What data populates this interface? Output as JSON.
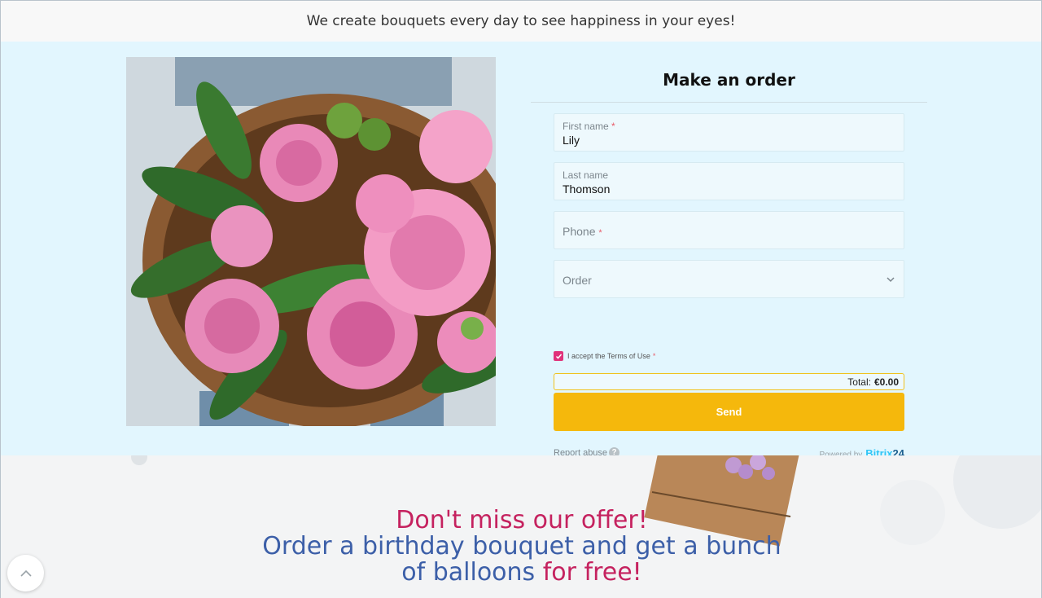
{
  "header": {
    "tagline": "We create bouquets every day to see happiness in your eyes!"
  },
  "form": {
    "title": "Make an order",
    "fields": {
      "first_name": {
        "label": "First name",
        "required_mark": "*",
        "value": "Lily"
      },
      "last_name": {
        "label": "Last name",
        "value": "Thomson"
      },
      "phone": {
        "placeholder": "Phone",
        "required_mark": "*"
      },
      "order": {
        "placeholder": "Order"
      }
    },
    "terms": {
      "label": "I accept the Terms of Use",
      "required_mark": "*",
      "checked": true
    },
    "total": {
      "label": "Total:",
      "value": "€0.00"
    },
    "send_label": "Send",
    "report_abuse": "Report abuse",
    "help_glyph": "?",
    "powered_by": "Powered by",
    "brand_name": "Bitrix",
    "brand_suffix": "24"
  },
  "promo": {
    "line1": "Don't miss our offer!",
    "line2": "Order a birthday bouquet and get a bunch",
    "line3_blue": "of balloons",
    "line3_pink": "for free!"
  },
  "icons": {
    "chevron": "chevron-down-icon",
    "scroll_top": "chevron-up-icon",
    "check": "check-icon"
  },
  "colors": {
    "accent_button": "#f5b80c",
    "form_background": "#e2f6fe",
    "checkbox": "#e0327a",
    "promo_pink": "#c5225f",
    "promo_blue": "#3c5fa8",
    "brand": "#2fc6f6"
  }
}
